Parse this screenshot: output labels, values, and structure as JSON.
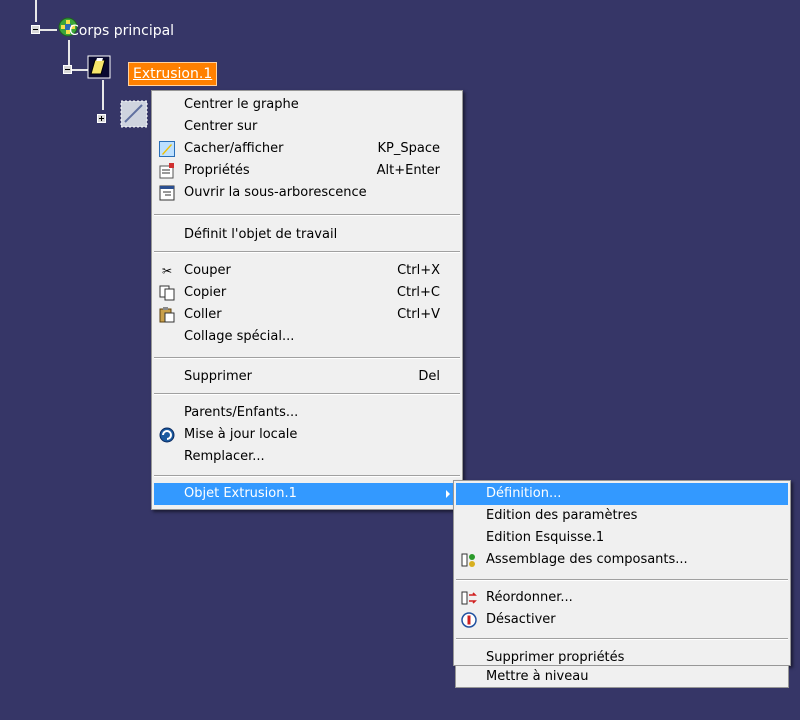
{
  "tree": {
    "root_label": "Corps principal",
    "extrusion_label": "Extrusion.1"
  },
  "context_menu": {
    "items": [
      {
        "label": "Centrer le graphe"
      },
      {
        "label": "Centrer sur"
      },
      {
        "label": "Cacher/afficher",
        "accel": "KP_Space",
        "icon": "hide-show-icon"
      },
      {
        "label": "Propriétés",
        "accel": "Alt+Enter",
        "icon": "properties-icon"
      },
      {
        "label": "Ouvrir la sous-arborescence",
        "icon": "open-subtree-icon"
      },
      {
        "label": "Définit l'objet de travail"
      },
      {
        "label": "Couper",
        "accel": "Ctrl+X",
        "icon": "scissors-icon"
      },
      {
        "label": "Copier",
        "accel": "Ctrl+C",
        "icon": "copy-icon"
      },
      {
        "label": "Coller",
        "accel": "Ctrl+V",
        "icon": "paste-icon"
      },
      {
        "label": "Collage spécial..."
      },
      {
        "label": "Supprimer",
        "accel": "Del"
      },
      {
        "label": "Parents/Enfants..."
      },
      {
        "label": "Mise à jour locale",
        "icon": "local-update-icon"
      },
      {
        "label": "Remplacer..."
      },
      {
        "label": "Objet Extrusion.1"
      }
    ]
  },
  "submenu": {
    "items": [
      {
        "label": "Définition..."
      },
      {
        "label": "Edition des paramètres"
      },
      {
        "label": "Edition Esquisse.1"
      },
      {
        "label": "Assemblage des composants...",
        "icon": "assemble-icon"
      },
      {
        "label": "Réordonner...",
        "icon": "reorder-icon"
      },
      {
        "label": "Désactiver",
        "icon": "deactivate-icon"
      },
      {
        "label": "Supprimer propriétés"
      },
      {
        "label": "Mettre à niveau"
      }
    ]
  },
  "colors": {
    "background": "#363667",
    "highlight": "#3399ff",
    "selected_node": "#ff8000"
  }
}
